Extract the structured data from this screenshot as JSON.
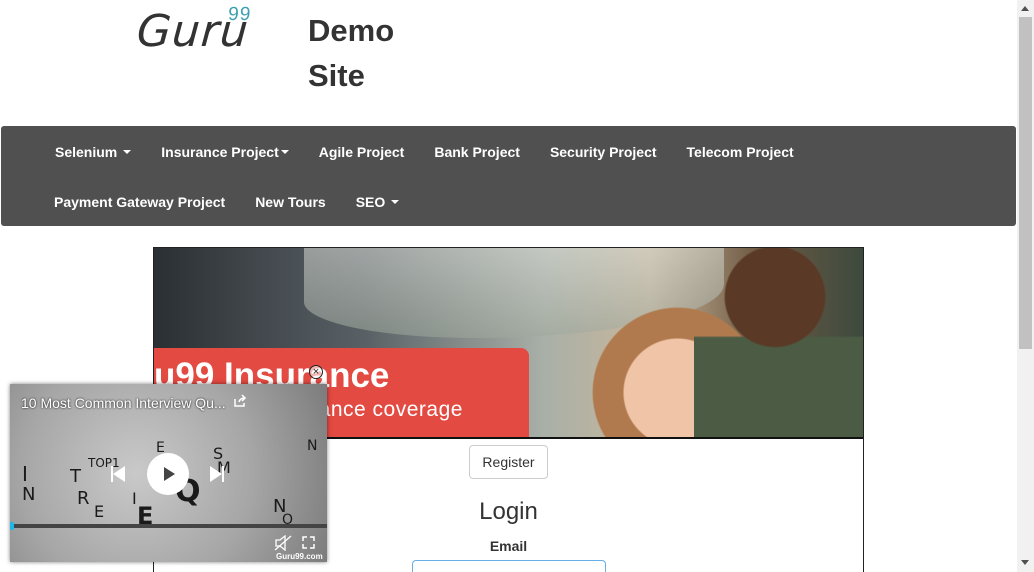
{
  "header": {
    "logo_text": "Guru",
    "logo_superscript": "99",
    "site_title_line1": "Demo",
    "site_title_line2": "Site"
  },
  "navbar": {
    "row1": [
      {
        "label": "Selenium",
        "dropdown": true
      },
      {
        "label": "Insurance Project",
        "dropdown": true
      },
      {
        "label": "Agile Project",
        "dropdown": false
      },
      {
        "label": "Bank Project",
        "dropdown": false
      },
      {
        "label": "Security Project",
        "dropdown": false
      },
      {
        "label": "Telecom Project",
        "dropdown": false
      }
    ],
    "row2": [
      {
        "label": "Payment Gateway Project",
        "dropdown": false
      },
      {
        "label": "New Tours",
        "dropdown": false
      },
      {
        "label": "SEO",
        "dropdown": true
      }
    ]
  },
  "banner": {
    "title": "u99 Insurance",
    "subtitle": "urance  coverage"
  },
  "main": {
    "register_label": "Register",
    "login_title": "Login",
    "email_label": "Email"
  },
  "video": {
    "title": "10 Most Common Interview Qu...",
    "brand": "Guru99.com",
    "progress_fraction": 0.005
  },
  "colors": {
    "navbar_bg": "#505050",
    "logo_accent": "#3ea0b0",
    "banner_red": "#e24a42",
    "video_progress": "#1fb7e8"
  }
}
